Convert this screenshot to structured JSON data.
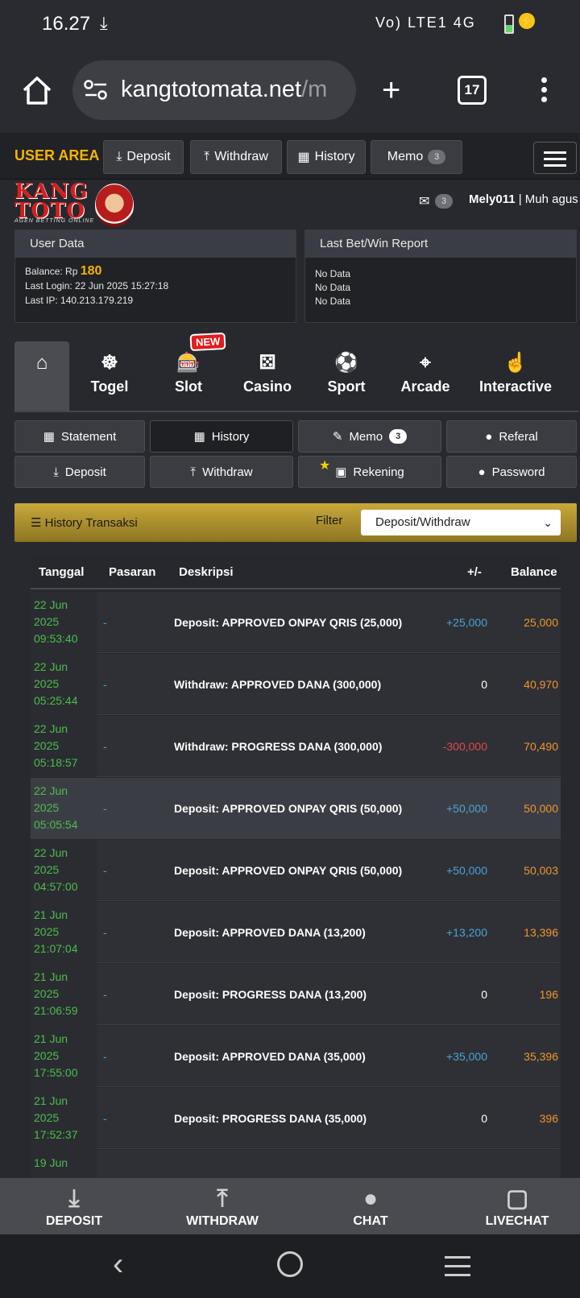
{
  "status_bar": {
    "time": "16.27",
    "network": "Vo) LTE1 4G"
  },
  "browser": {
    "url_main": "kangtotomata.net",
    "url_rest": "/m",
    "tab_count": "17"
  },
  "nav": {
    "user_area": "USER AREA",
    "deposit": "Deposit",
    "withdraw": "Withdraw",
    "history": "History",
    "memo": "Memo",
    "memo_count": "3"
  },
  "logo": {
    "line1": "KANG",
    "line2": "TOTO",
    "tagline": "AGEN BETTING ONLINE"
  },
  "user": {
    "mail_count": "3",
    "username": "Mely011",
    "nickname": "| Muh agus"
  },
  "user_data": {
    "title": "User Data",
    "balance_label": "Balance: Rp",
    "balance": "180",
    "last_login": "Last Login: 22 Jun 2025 15:27:18",
    "last_ip": "Last IP: 140.213.179.219"
  },
  "report": {
    "title": "Last Bet/Win Report",
    "lines": [
      "No Data",
      "No Data",
      "No Data"
    ]
  },
  "game_tabs": [
    "Togel",
    "Slot",
    "Casino",
    "Sport",
    "Arcade",
    "Interactive"
  ],
  "new_tag": "NEW",
  "account_buttons": {
    "statement": "Statement",
    "history": "History",
    "memo": "Memo",
    "memo_count": "3",
    "referal": "Referal",
    "deposit": "Deposit",
    "withdraw": "Withdraw",
    "rekening": "Rekening",
    "password": "Password"
  },
  "history": {
    "title": "History Transaksi",
    "filter_label": "Filter",
    "filter_value": "Deposit/Withdraw",
    "columns": [
      "Tanggal",
      "Pasaran",
      "Deskripsi",
      "+/-",
      "Balance"
    ],
    "rows": [
      {
        "d1": "22 Jun",
        "d2": "2025",
        "d3": "09:53:40",
        "pasaran": "-",
        "desc": "Deposit: APPROVED ONPAY QRIS (25,000)",
        "amt": "+25,000",
        "bal": "25,000"
      },
      {
        "d1": "22 Jun",
        "d2": "2025",
        "d3": "05:25:44",
        "pasaran": "-",
        "desc": "Withdraw: APPROVED DANA (300,000)",
        "amt": "0",
        "bal": "40,970"
      },
      {
        "d1": "22 Jun",
        "d2": "2025",
        "d3": "05:18:57",
        "pasaran": "-",
        "desc": "Withdraw: PROGRESS DANA (300,000)",
        "amt": "-300,000",
        "bal": "70,490"
      },
      {
        "d1": "22 Jun",
        "d2": "2025",
        "d3": "05:05:54",
        "pasaran": "-",
        "desc": "Deposit: APPROVED ONPAY QRIS (50,000)",
        "amt": "+50,000",
        "bal": "50,000"
      },
      {
        "d1": "22 Jun",
        "d2": "2025",
        "d3": "04:57:00",
        "pasaran": "-",
        "desc": "Deposit: APPROVED ONPAY QRIS (50,000)",
        "amt": "+50,000",
        "bal": "50,003"
      },
      {
        "d1": "21 Jun",
        "d2": "2025",
        "d3": "21:07:04",
        "pasaran": "-",
        "desc": "Deposit: APPROVED DANA (13,200)",
        "amt": "+13,200",
        "bal": "13,396"
      },
      {
        "d1": "21 Jun",
        "d2": "2025",
        "d3": "21:06:59",
        "pasaran": "-",
        "desc": "Deposit: PROGRESS DANA (13,200)",
        "amt": "0",
        "bal": "196"
      },
      {
        "d1": "21 Jun",
        "d2": "2025",
        "d3": "17:55:00",
        "pasaran": "-",
        "desc": "Deposit: APPROVED DANA (35,000)",
        "amt": "+35,000",
        "bal": "35,396"
      },
      {
        "d1": "21 Jun",
        "d2": "2025",
        "d3": "17:52:37",
        "pasaran": "-",
        "desc": "Deposit: PROGRESS DANA (35,000)",
        "amt": "0",
        "bal": "396"
      },
      {
        "d1": "19 Jun",
        "d2": "",
        "d3": "",
        "pasaran": "",
        "desc": "",
        "amt": "",
        "bal": ""
      }
    ]
  },
  "bottom_bar": [
    "DEPOSIT",
    "WITHDRAW",
    "CHAT",
    "LIVECHAT"
  ]
}
